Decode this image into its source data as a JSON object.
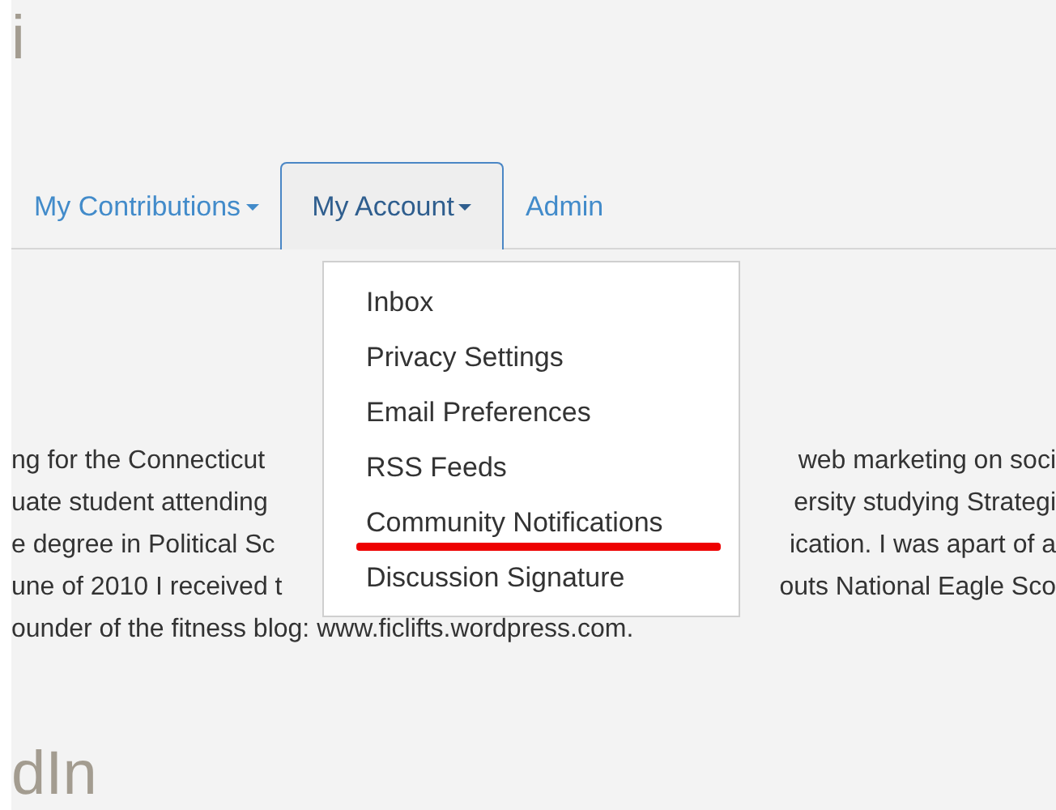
{
  "page_title": "i",
  "tabs": [
    {
      "label": "My Contributions",
      "selected": false,
      "has_caret": true
    },
    {
      "label": "My Account",
      "selected": true,
      "has_caret": true
    },
    {
      "label": "Admin",
      "selected": false,
      "has_caret": false
    }
  ],
  "dropdown": {
    "items": [
      {
        "label": "Inbox",
        "underlined": false
      },
      {
        "label": "Privacy Settings",
        "underlined": false
      },
      {
        "label": "Email Preferences",
        "underlined": false
      },
      {
        "label": "RSS Feeds",
        "underlined": false
      },
      {
        "label": "Community Notifications",
        "underlined": true
      },
      {
        "label": "Discussion Signature",
        "underlined": false
      }
    ]
  },
  "bio_lines": [
    {
      "left": "ng for the Connecticut",
      "right": "web marketing on soci"
    },
    {
      "left": "uate student attending",
      "right": "ersity studying Strategi"
    },
    {
      "left": "e degree in Political Sc",
      "right": "ication. I was apart of a"
    },
    {
      "left": "une of 2010 I received t",
      "right": "outs National Eagle Sco"
    },
    {
      "left": "ounder of the fitness blog: www.ficlifts.wordpress.com."
    }
  ],
  "section_heading": "dIn"
}
